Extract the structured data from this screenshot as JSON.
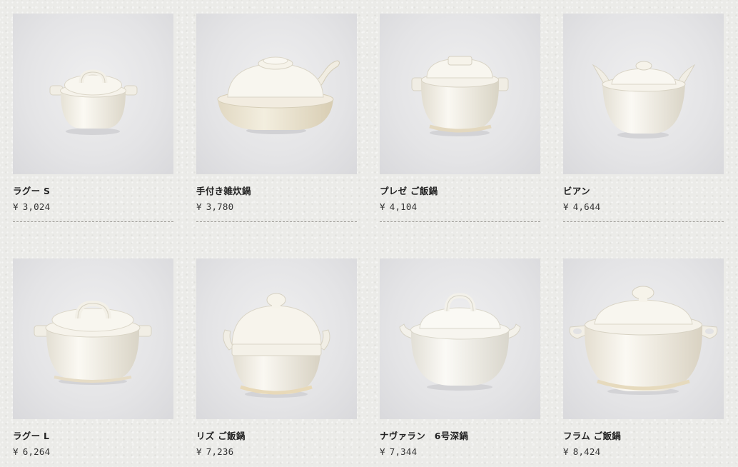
{
  "products": [
    {
      "name": "ラグー S",
      "currency": "¥",
      "price": "3,024",
      "image": "pot-small-handled-icon"
    },
    {
      "name": "手付き雑炊鍋",
      "currency": "¥",
      "price": "3,780",
      "image": "pot-long-handle-icon"
    },
    {
      "name": "プレゼ ご飯鍋",
      "currency": "¥",
      "price": "4,104",
      "image": "rice-pot-square-handle-icon"
    },
    {
      "name": "ビアン",
      "currency": "¥",
      "price": "4,644",
      "image": "pot-wing-handle-icon"
    },
    {
      "name": "ラグー L",
      "currency": "¥",
      "price": "6,264",
      "image": "pot-large-handled-icon"
    },
    {
      "name": "リズ ご飯鍋",
      "currency": "¥",
      "price": "7,236",
      "image": "rice-pot-knob-icon"
    },
    {
      "name": "ナヴァラン　6号深鍋",
      "currency": "¥",
      "price": "7,344",
      "image": "deep-pot-icon"
    },
    {
      "name": "フラム ご飯鍋",
      "currency": "¥",
      "price": "8,424",
      "image": "rice-pot-loop-handle-icon"
    }
  ],
  "colors": {
    "background": "#ebebe8",
    "photo_background": "#e4e4e6",
    "pot_glaze": "#f4f1e8",
    "divider": "#9c9a95"
  }
}
